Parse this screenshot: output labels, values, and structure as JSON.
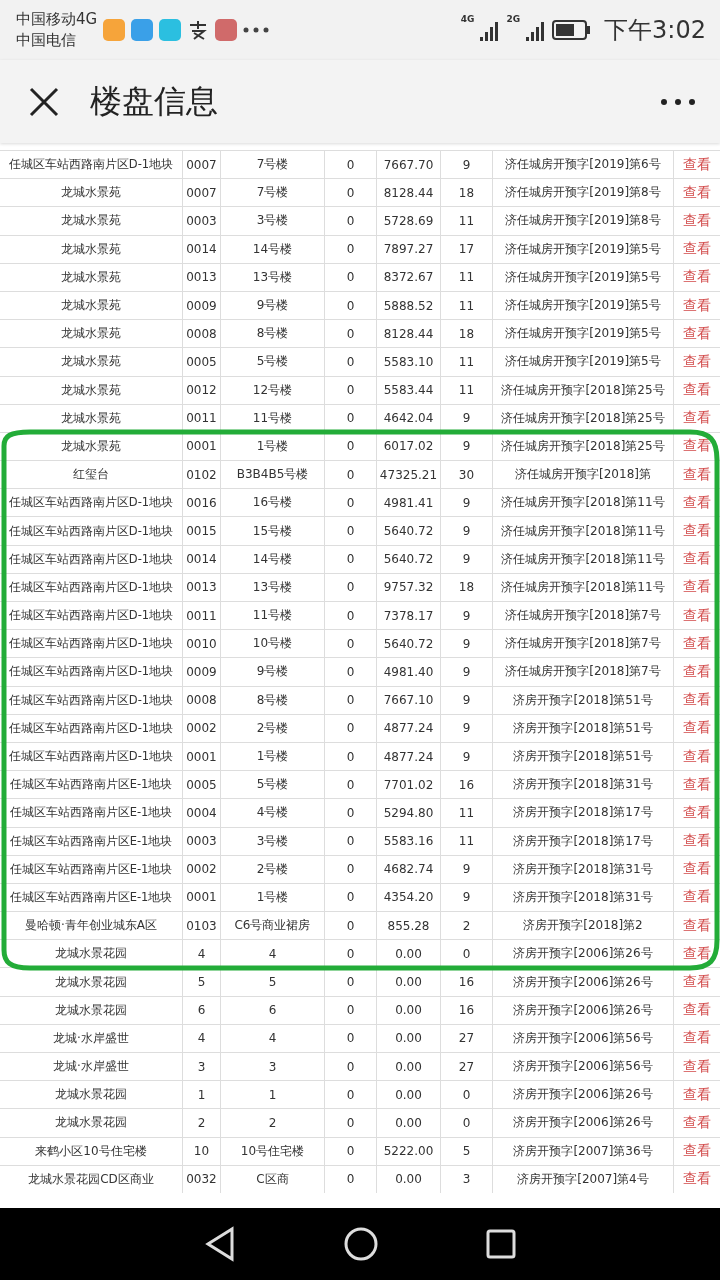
{
  "status_bar": {
    "carriers": [
      "中国移动4G",
      "中国电信"
    ],
    "network_labels": [
      "4G",
      "2G"
    ],
    "time": "下午3:02"
  },
  "header": {
    "title": "楼盘信息"
  },
  "table": {
    "rows": [
      {
        "cells": [
          "任城区车站西路南片区D-1地块",
          "0007",
          "7号楼",
          "0",
          "7667.70",
          "9",
          "济任城房开预字[2019]第6号"
        ],
        "action": "查看"
      },
      {
        "cells": [
          "龙城水景苑",
          "0007",
          "7号楼",
          "0",
          "8128.44",
          "18",
          "济任城房开预字[2019]第8号"
        ],
        "action": "查看"
      },
      {
        "cells": [
          "龙城水景苑",
          "0003",
          "3号楼",
          "0",
          "5728.69",
          "11",
          "济任城房开预字[2019]第8号"
        ],
        "action": "查看"
      },
      {
        "cells": [
          "龙城水景苑",
          "0014",
          "14号楼",
          "0",
          "7897.27",
          "17",
          "济任城房开预字[2019]第5号"
        ],
        "action": "查看"
      },
      {
        "cells": [
          "龙城水景苑",
          "0013",
          "13号楼",
          "0",
          "8372.67",
          "11",
          "济任城房开预字[2019]第5号"
        ],
        "action": "查看"
      },
      {
        "cells": [
          "龙城水景苑",
          "0009",
          "9号楼",
          "0",
          "5888.52",
          "11",
          "济任城房开预字[2019]第5号"
        ],
        "action": "查看"
      },
      {
        "cells": [
          "龙城水景苑",
          "0008",
          "8号楼",
          "0",
          "8128.44",
          "18",
          "济任城房开预字[2019]第5号"
        ],
        "action": "查看"
      },
      {
        "cells": [
          "龙城水景苑",
          "0005",
          "5号楼",
          "0",
          "5583.10",
          "11",
          "济任城房开预字[2019]第5号"
        ],
        "action": "查看"
      },
      {
        "cells": [
          "龙城水景苑",
          "0012",
          "12号楼",
          "0",
          "5583.44",
          "11",
          "济任城房开预字[2018]第25号"
        ],
        "action": "查看"
      },
      {
        "cells": [
          "龙城水景苑",
          "0011",
          "11号楼",
          "0",
          "4642.04",
          "9",
          "济任城房开预字[2018]第25号"
        ],
        "action": "查看"
      },
      {
        "cells": [
          "龙城水景苑",
          "0001",
          "1号楼",
          "0",
          "6017.02",
          "9",
          "济任城房开预字[2018]第25号"
        ],
        "action": "查看"
      },
      {
        "cells": [
          "红玺台",
          "0102",
          "B3B4B5号楼",
          "0",
          "47325.21",
          "30",
          "济任城房开预字[2018]第"
        ],
        "action": "查看"
      },
      {
        "cells": [
          "任城区车站西路南片区D-1地块",
          "0016",
          "16号楼",
          "0",
          "4981.41",
          "9",
          "济任城房开预字[2018]第11号"
        ],
        "action": "查看"
      },
      {
        "cells": [
          "任城区车站西路南片区D-1地块",
          "0015",
          "15号楼",
          "0",
          "5640.72",
          "9",
          "济任城房开预字[2018]第11号"
        ],
        "action": "查看"
      },
      {
        "cells": [
          "任城区车站西路南片区D-1地块",
          "0014",
          "14号楼",
          "0",
          "5640.72",
          "9",
          "济任城房开预字[2018]第11号"
        ],
        "action": "查看"
      },
      {
        "cells": [
          "任城区车站西路南片区D-1地块",
          "0013",
          "13号楼",
          "0",
          "9757.32",
          "18",
          "济任城房开预字[2018]第11号"
        ],
        "action": "查看"
      },
      {
        "cells": [
          "任城区车站西路南片区D-1地块",
          "0011",
          "11号楼",
          "0",
          "7378.17",
          "9",
          "济任城房开预字[2018]第7号"
        ],
        "action": "查看"
      },
      {
        "cells": [
          "任城区车站西路南片区D-1地块",
          "0010",
          "10号楼",
          "0",
          "5640.72",
          "9",
          "济任城房开预字[2018]第7号"
        ],
        "action": "查看"
      },
      {
        "cells": [
          "任城区车站西路南片区D-1地块",
          "0009",
          "9号楼",
          "0",
          "4981.40",
          "9",
          "济任城房开预字[2018]第7号"
        ],
        "action": "查看"
      },
      {
        "cells": [
          "任城区车站西路南片区D-1地块",
          "0008",
          "8号楼",
          "0",
          "7667.10",
          "9",
          "济房开预字[2018]第51号"
        ],
        "action": "查看"
      },
      {
        "cells": [
          "任城区车站西路南片区D-1地块",
          "0002",
          "2号楼",
          "0",
          "4877.24",
          "9",
          "济房开预字[2018]第51号"
        ],
        "action": "查看"
      },
      {
        "cells": [
          "任城区车站西路南片区D-1地块",
          "0001",
          "1号楼",
          "0",
          "4877.24",
          "9",
          "济房开预字[2018]第51号"
        ],
        "action": "查看"
      },
      {
        "cells": [
          "任城区车站西路南片区E-1地块",
          "0005",
          "5号楼",
          "0",
          "7701.02",
          "16",
          "济房开预字[2018]第31号"
        ],
        "action": "查看"
      },
      {
        "cells": [
          "任城区车站西路南片区E-1地块",
          "0004",
          "4号楼",
          "0",
          "5294.80",
          "11",
          "济房开预字[2018]第17号"
        ],
        "action": "查看"
      },
      {
        "cells": [
          "任城区车站西路南片区E-1地块",
          "0003",
          "3号楼",
          "0",
          "5583.16",
          "11",
          "济房开预字[2018]第17号"
        ],
        "action": "查看"
      },
      {
        "cells": [
          "任城区车站西路南片区E-1地块",
          "0002",
          "2号楼",
          "0",
          "4682.74",
          "9",
          "济房开预字[2018]第31号"
        ],
        "action": "查看"
      },
      {
        "cells": [
          "任城区车站西路南片区E-1地块",
          "0001",
          "1号楼",
          "0",
          "4354.20",
          "9",
          "济房开预字[2018]第31号"
        ],
        "action": "查看"
      },
      {
        "cells": [
          "曼哈顿·青年创业城东A区",
          "0103",
          "C6号商业裙房",
          "0",
          "855.28",
          "2",
          "济房开预字[2018]第2"
        ],
        "action": "查看"
      },
      {
        "cells": [
          "龙城水景花园",
          "4",
          "4",
          "0",
          "0.00",
          "0",
          "济房开预字[2006]第26号"
        ],
        "action": "查看"
      },
      {
        "cells": [
          "龙城水景花园",
          "5",
          "5",
          "0",
          "0.00",
          "16",
          "济房开预字[2006]第26号"
        ],
        "action": "查看"
      },
      {
        "cells": [
          "龙城水景花园",
          "6",
          "6",
          "0",
          "0.00",
          "16",
          "济房开预字[2006]第26号"
        ],
        "action": "查看"
      },
      {
        "cells": [
          "龙城·水岸盛世",
          "4",
          "4",
          "0",
          "0.00",
          "27",
          "济房开预字[2006]第56号"
        ],
        "action": "查看"
      },
      {
        "cells": [
          "龙城·水岸盛世",
          "3",
          "3",
          "0",
          "0.00",
          "27",
          "济房开预字[2006]第56号"
        ],
        "action": "查看"
      },
      {
        "cells": [
          "龙城水景花园",
          "1",
          "1",
          "0",
          "0.00",
          "0",
          "济房开预字[2006]第26号"
        ],
        "action": "查看"
      },
      {
        "cells": [
          "龙城水景花园",
          "2",
          "2",
          "0",
          "0.00",
          "0",
          "济房开预字[2006]第26号"
        ],
        "action": "查看"
      },
      {
        "cells": [
          "来鹤小区10号住宅楼",
          "10",
          "10号住宅楼",
          "0",
          "5222.00",
          "5",
          "济房开预字[2007]第36号"
        ],
        "action": "查看"
      },
      {
        "cells": [
          "龙城水景花园CD区商业",
          "0032",
          "C区商",
          "0",
          "0.00",
          "3",
          "济房开预字[2007]第4号"
        ],
        "action": "查看"
      }
    ]
  }
}
